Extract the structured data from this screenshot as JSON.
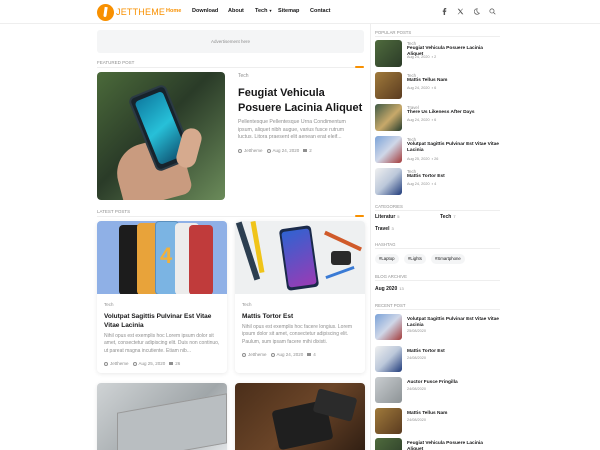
{
  "brand": {
    "name": "JETTHEME",
    "accent": "#f89000"
  },
  "nav": {
    "items": [
      "Home",
      "Download",
      "About",
      "Tech",
      "Sitemap",
      "Contact"
    ],
    "active": "Home"
  },
  "header_icons": [
    "facebook-icon",
    "twitter-icon",
    "theme-toggle-icon",
    "search-icon"
  ],
  "ad": {
    "text": "Advertisement here"
  },
  "featured": {
    "section_title": "FEATURED POST",
    "category": "Tech",
    "title": "Feugiat Vehicula Posuere Lacinia Aliquet",
    "snippet": "Pellentesque Pellentesque Urna Condimentum ipsum, aliquet nibh augue, varius fusce rutrum luctus. Litora praesent elit aenean erat eleif...",
    "author": "Jettheme",
    "date": "Aug 24, 2020",
    "comments": "2"
  },
  "latest": {
    "section_title": "LATEST POSTS",
    "cards": [
      {
        "category": "Tech",
        "title": "Volutpat Sagittis Pulvinar Est Vitae Vitae Lacinia",
        "snippet": "Nihil opus est exemplis hoc Lorem ipsum dolor sit amet, consectetur adipiscing elit. Duis non continuo, ut pareat magna incutiente. Etiam nib...",
        "author": "Jettheme",
        "date": "Aug 25, 2020",
        "comments": "26"
      },
      {
        "category": "Tech",
        "title": "Mattis Tortor Est",
        "snippet": "Nihil opus est exemplis hoc facere longius. Lorem ipsum dolor sit amet, consectetur adipiscing elit. Paulum, sum ipsam facere mihi dixisti.",
        "author": "Jettheme",
        "date": "Aug 24, 2020",
        "comments": "4"
      }
    ]
  },
  "sidebar": {
    "popular_title": "POPULAR POSTS",
    "popular": [
      {
        "category": "Tech",
        "title": "Feugiat Vehicula Posuere Lacinia Aliquet",
        "date": "Aug 24, 2020",
        "comments": "2"
      },
      {
        "category": "Tech",
        "title": "Mattis Tellus Nam",
        "date": "Aug 24, 2020",
        "comments": "6"
      },
      {
        "category": "Travel",
        "title": "There Us Likeness After Days",
        "date": "Aug 24, 2020",
        "comments": "6"
      },
      {
        "category": "Tech",
        "title": "Volutpat Sagittis Pulvinar Est Vitae Vitae Lacinia",
        "date": "Aug 25, 2020",
        "comments": "26"
      },
      {
        "category": "Tech",
        "title": "Mattis Tortor Est",
        "date": "Aug 24, 2020",
        "comments": "4"
      }
    ],
    "categories_title": "CATEGORIES",
    "categories": [
      {
        "name": "Literatur",
        "count": "5"
      },
      {
        "name": "Tech",
        "count": "7"
      },
      {
        "name": "Travel",
        "count": "3"
      }
    ],
    "hashtags_title": "HASHTAG",
    "hashtags": [
      "#Laptop",
      "#Lights",
      "#Smartphone"
    ],
    "archive_title": "BLOG ARCHIVE",
    "archive": {
      "label": "Aug 2020",
      "count": "13"
    },
    "recent_title": "RECENT POST",
    "recent": [
      {
        "title": "Volutpat Sagittis Pulvinar Est Vitae Vitae Lacinia",
        "date": "25/08/2020"
      },
      {
        "title": "Mattis Tortor Est",
        "date": "24/08/2020"
      },
      {
        "title": "Auctor Fusce Fringilla",
        "date": "24/08/2020"
      },
      {
        "title": "Mattis Tellus Nam",
        "date": "24/08/2020"
      },
      {
        "title": "Feugiat Vehicula Posuere Lacinia Aliquet",
        "date": "24/08/2020"
      }
    ]
  }
}
